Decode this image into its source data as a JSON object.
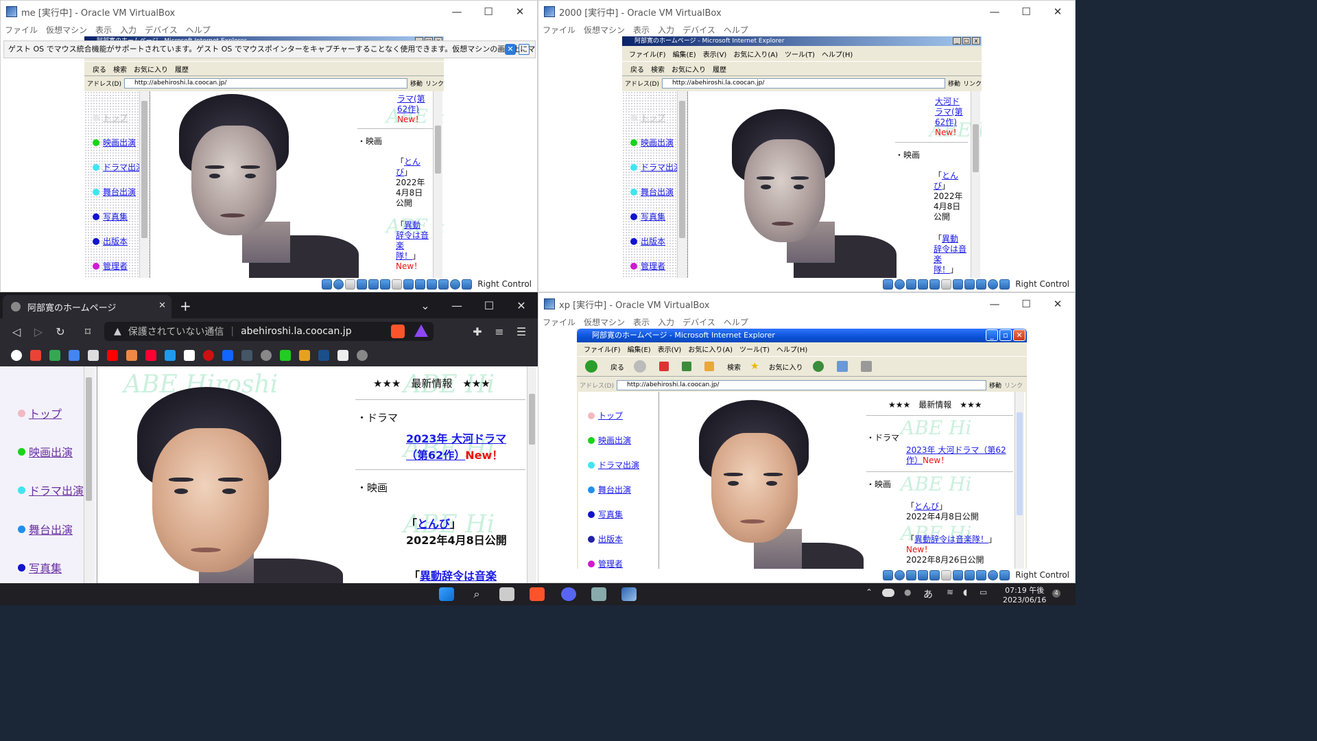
{
  "vb_menu": [
    "ファイル",
    "仮想マシン",
    "表示",
    "入力",
    "デバイス",
    "ヘルプ"
  ],
  "vb_host_key": "Right Control",
  "vms": {
    "me": {
      "title": "me [実行中] - Oracle VM VirtualBox"
    },
    "w2000": {
      "title": "2000 [実行中] - Oracle VM VirtualBox"
    },
    "xp": {
      "title": "xp [実行中] - Oracle VM VirtualBox"
    }
  },
  "notification": {
    "text": "ゲスト OS でマウス統合機能がサポートされています。ゲスト OS でマウスポインターをキャプチャーすることなく使用できます。仮想マシンの画面上にマウスポイ"
  },
  "ie": {
    "title": "阿部寛のホームページ - Microsoft Internet Explorer",
    "menu": [
      "ファイル(F)",
      "編集(E)",
      "表示(V)",
      "お気に入り(A)",
      "ツール(T)",
      "ヘルプ(H)"
    ],
    "toolbar_w2k": [
      "戻る",
      "検索",
      "お気に入り",
      "履歴"
    ],
    "toolbar_xp": [
      "戻る",
      "検索",
      "お気に入り"
    ],
    "address_label": "アドレス(D)",
    "url": "http://abehiroshi.la.coocan.jp/",
    "go": "移動",
    "links": "リンク"
  },
  "site": {
    "nav": [
      "トップ",
      "映画出演",
      "ドラマ出演",
      "舞台出演",
      "写真集",
      "出版本",
      "管理者"
    ],
    "nav_colors": [
      "#f4b9c0",
      "#18d418",
      "#3ee6f0",
      "#1e90f0",
      "#1212d0",
      "#2222aa",
      "#d01ad0"
    ],
    "news_header": "★★★　最新情報　★★★",
    "drama_label": "・ドラマ",
    "drama_title": "2023年 大河ドラマ（第62作）",
    "drama_a": "2023年 大河ドラマ",
    "drama_b": "（第62作）",
    "new_badge": "New！",
    "movie_label": "・映画",
    "movie1_title": "とんび",
    "movie1_date": "2022年4月8日公開",
    "movie2_title": "異動辞令は音楽隊！",
    "movie2_title_partial": "異動辞令は音楽",
    "movie2_date": "2022年8月26日公開",
    "watermark": "ABE Hiroshi",
    "watermark_short": "ABE Hi",
    "frag_a": "ラマ(第",
    "frag_b": "62作)",
    "frag_c": "大河ド"
  },
  "brave": {
    "tab_title": "阿部寛のホームページ",
    "insecure": "保護されていない通信",
    "url": "abehiroshi.la.coocan.jp"
  },
  "taskbar": {
    "time": "07:19 午後",
    "date": "2023/06/16",
    "ime": "あ",
    "badge": "4"
  }
}
